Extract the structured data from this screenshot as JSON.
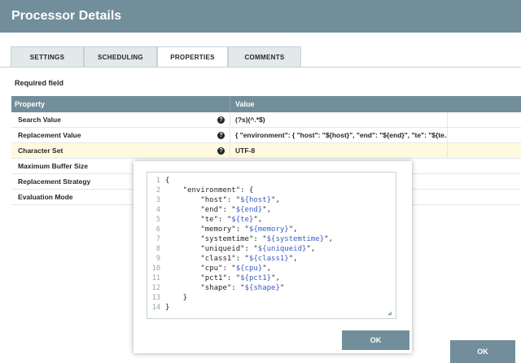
{
  "dialog": {
    "title": "Processor Details"
  },
  "tabs": [
    {
      "label": "SETTINGS"
    },
    {
      "label": "SCHEDULING"
    },
    {
      "label": "PROPERTIES"
    },
    {
      "label": "COMMENTS"
    }
  ],
  "active_tab": "PROPERTIES",
  "required_field": "Required field",
  "grid": {
    "headers": {
      "property": "Property",
      "value": "Value"
    },
    "rows": [
      {
        "property": "Search Value",
        "value": "(?s)(^.*$)"
      },
      {
        "property": "Replacement Value",
        "value": "{ \"environment\": { \"host\": \"${host}\", \"end\": \"${end}\", \"te\": \"${te..."
      },
      {
        "property": "Character Set",
        "value": "UTF-8"
      },
      {
        "property": "Maximum Buffer Size",
        "value": ""
      },
      {
        "property": "Replacement Strategy",
        "value": ""
      },
      {
        "property": "Evaluation Mode",
        "value": ""
      }
    ]
  },
  "editor": {
    "lines": [
      {
        "n": "1",
        "pre": "{",
        "var": "",
        "post": ""
      },
      {
        "n": "2",
        "pre": "    \"environment\": {",
        "var": "",
        "post": ""
      },
      {
        "n": "3",
        "pre": "        \"host\": \"",
        "var": "${host}",
        "post": "\","
      },
      {
        "n": "4",
        "pre": "        \"end\": \"",
        "var": "${end}",
        "post": "\","
      },
      {
        "n": "5",
        "pre": "        \"te\": \"",
        "var": "${te}",
        "post": "\","
      },
      {
        "n": "6",
        "pre": "        \"memory\": \"",
        "var": "${memory}",
        "post": "\","
      },
      {
        "n": "7",
        "pre": "        \"systemtime\": \"",
        "var": "${systemtime}",
        "post": "\","
      },
      {
        "n": "8",
        "pre": "        \"uniqueid\": \"",
        "var": "${uniqueid}",
        "post": "\","
      },
      {
        "n": "9",
        "pre": "        \"class1\": \"",
        "var": "${class1}",
        "post": "\","
      },
      {
        "n": "10",
        "pre": "        \"cpu\": \"",
        "var": "${cpu}",
        "post": "\","
      },
      {
        "n": "11",
        "pre": "        \"pct1\": \"",
        "var": "${pct1}",
        "post": "\","
      },
      {
        "n": "12",
        "pre": "        \"shape\": \"",
        "var": "${shape}",
        "post": "\""
      },
      {
        "n": "13",
        "pre": "    }",
        "var": "",
        "post": ""
      },
      {
        "n": "14",
        "pre": "}",
        "var": "",
        "post": ""
      }
    ],
    "ok_label": "OK"
  },
  "footer": {
    "ok_label": "OK"
  },
  "colors": {
    "header": "#728e9b",
    "selected_row": "#fffadf",
    "variable": "#3d5cc4"
  }
}
